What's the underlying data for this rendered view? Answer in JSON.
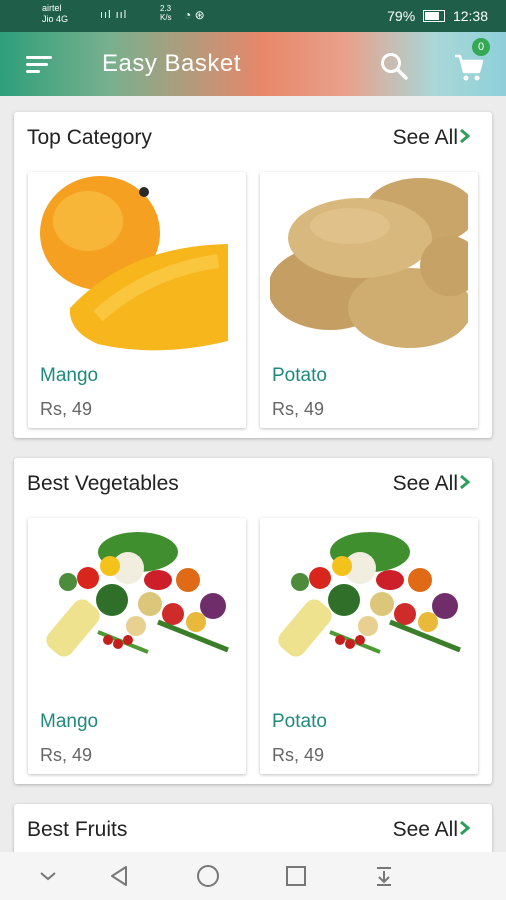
{
  "status_bar": {
    "carrier_line1": "airtel",
    "carrier_line2": "Jio 4G",
    "signal_text": "ııl ııl",
    "speed": "2.3 K/s",
    "battery": "79%",
    "time": "12:38"
  },
  "app_bar": {
    "title": "Easy Basket",
    "cart_count": "0",
    "icons": [
      "menu-icon",
      "search-icon",
      "cart-icon"
    ]
  },
  "sections": [
    {
      "title": "Top Category",
      "see_all": "See All",
      "items": [
        {
          "name": "Mango",
          "price": "Rs, 49",
          "image": "mango-image"
        },
        {
          "name": "Potato",
          "price": "Rs, 49",
          "image": "potato-image"
        }
      ]
    },
    {
      "title": "Best Vegetables",
      "see_all": "See All",
      "items": [
        {
          "name": "Mango",
          "price": "Rs, 49",
          "image": "vegetables-image"
        },
        {
          "name": "Potato",
          "price": "Rs, 49",
          "image": "vegetables-image"
        }
      ]
    },
    {
      "title": "Best Fruits",
      "see_all": "See All",
      "items": []
    }
  ],
  "colors": {
    "status_bar": "#1f5f4a",
    "product_name": "#1f8a7c",
    "chevron": "#2e9e5b",
    "badge": "#34a853"
  },
  "nav_bar": {
    "icons": [
      "chevron-down-icon",
      "back-icon",
      "home-icon",
      "recents-icon",
      "download-icon"
    ]
  }
}
